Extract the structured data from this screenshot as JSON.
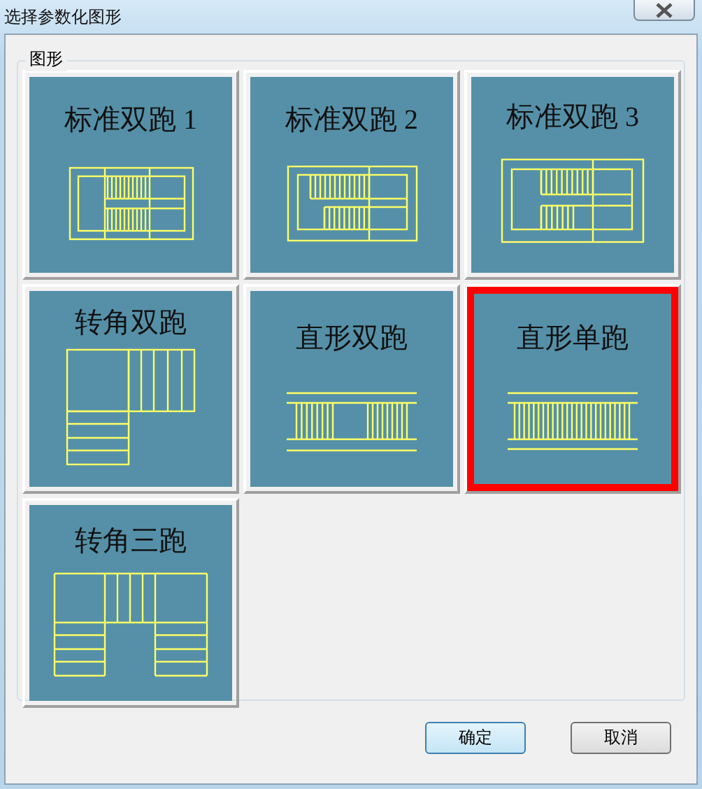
{
  "window": {
    "title": "选择参数化图形"
  },
  "group": {
    "label": "图形"
  },
  "options": [
    {
      "label": "标准双跑 1",
      "kind": "std1",
      "selected": false
    },
    {
      "label": "标准双跑 2",
      "kind": "std2",
      "selected": false
    },
    {
      "label": "标准双跑 3",
      "kind": "std3",
      "selected": false
    },
    {
      "label": "转角双跑",
      "kind": "corner2",
      "selected": false
    },
    {
      "label": "直形双跑",
      "kind": "straight2",
      "selected": false
    },
    {
      "label": "直形单跑",
      "kind": "straight1",
      "selected": true
    },
    {
      "label": "转角三跑",
      "kind": "corner3",
      "selected": false
    }
  ],
  "buttons": [
    {
      "label": "确定",
      "kind": "default"
    },
    {
      "label": "取消",
      "kind": "normal"
    }
  ]
}
